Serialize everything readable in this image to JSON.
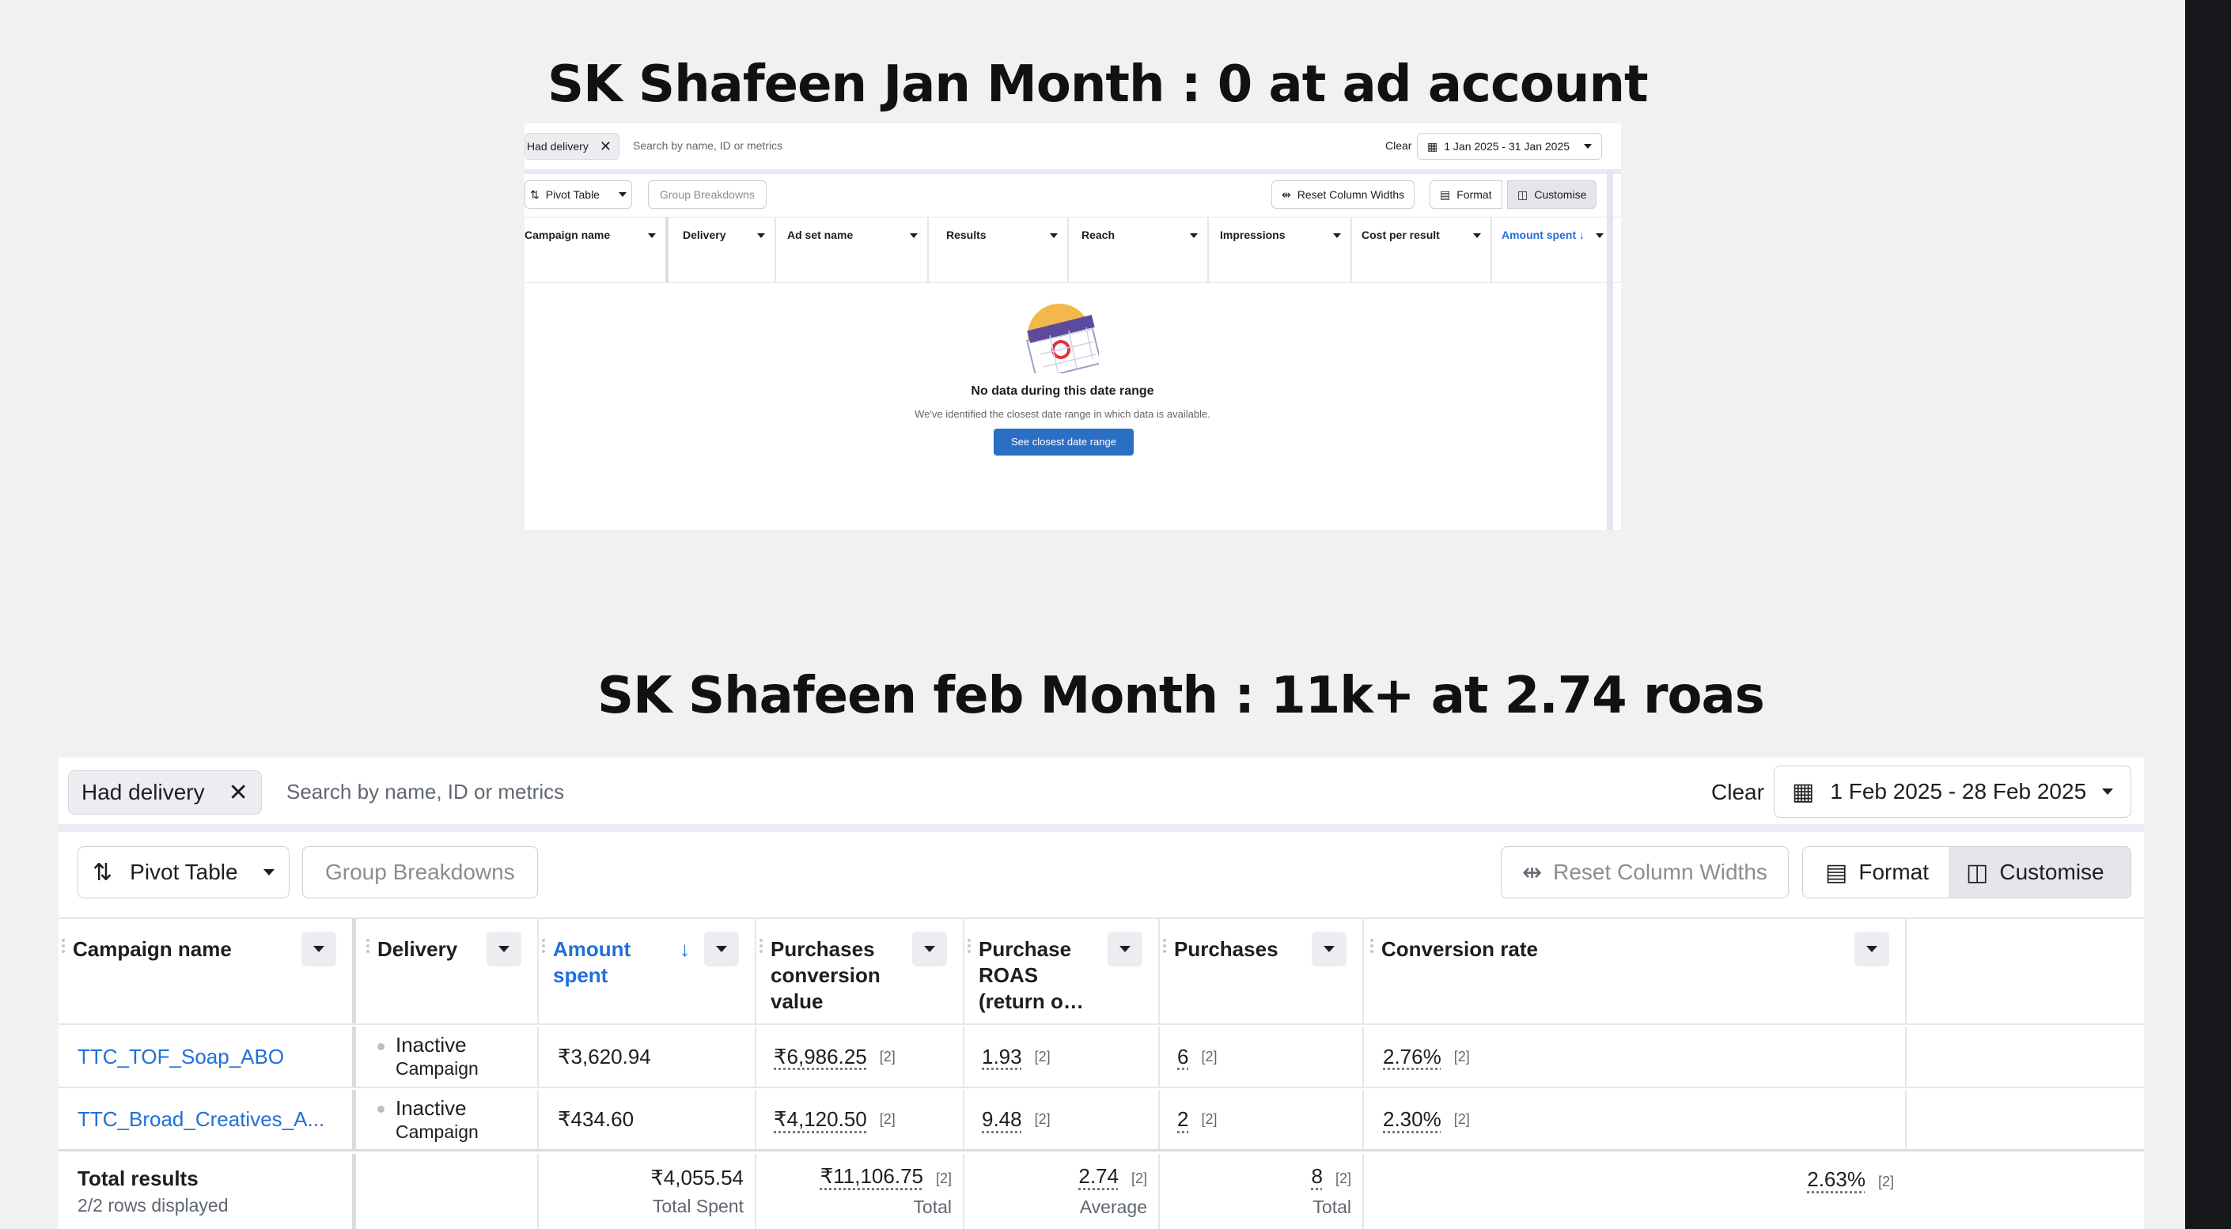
{
  "titles": {
    "jan": "SK Shafeen Jan Month  : 0 at ad account",
    "feb": "SK Shafeen feb Month  : 11k+ at 2.74 roas"
  },
  "jan_panel": {
    "filter_chip": "Had delivery",
    "search_placeholder": "Search by name, ID or metrics",
    "clear": "Clear",
    "date_range": "1 Jan 2025 - 31 Jan 2025",
    "pivot_table": "Pivot Table",
    "group_breakdowns": "Group Breakdowns",
    "reset_column_widths": "Reset Column Widths",
    "format": "Format",
    "customise": "Customise",
    "columns": [
      "Campaign name",
      "Delivery",
      "Ad set name",
      "Results",
      "Reach",
      "Impressions",
      "Cost per result",
      "Amount spent ↓"
    ],
    "empty_title": "No data during this date range",
    "empty_desc": "We've identified the closest date range in which data is available.",
    "empty_button": "See closest date range"
  },
  "feb_panel": {
    "filter_chip": "Had delivery",
    "search_placeholder": "Search by name, ID or metrics",
    "clear": "Clear",
    "date_range": "1 Feb 2025 - 28 Feb 2025",
    "pivot_table": "Pivot Table",
    "group_breakdowns": "Group Breakdowns",
    "reset_column_widths": "Reset Column Widths",
    "format": "Format",
    "customise": "Customise",
    "columns": {
      "campaign_name": "Campaign name",
      "delivery": "Delivery",
      "amount_spent_1": "Amount",
      "amount_spent_2": "spent",
      "purchases_value_1": "Purchases",
      "purchases_value_2": "conversion",
      "purchases_value_3": "value",
      "roas_1": "Purchase",
      "roas_2": "ROAS",
      "roas_3": "(return o…",
      "purchases": "Purchases",
      "conversion_rate": "Conversion rate"
    },
    "rows": [
      {
        "campaign": "TTC_TOF_Soap_ABO",
        "delivery": "Inactive",
        "delivery_sub": "Campaign",
        "amount_spent": "₹3,620.94",
        "purchase_value": "₹6,986.25",
        "roas": "1.93",
        "purchases": "6",
        "conversion_rate": "2.76%",
        "note": "[2]"
      },
      {
        "campaign": "TTC_Broad_Creatives_A...",
        "delivery": "Inactive",
        "delivery_sub": "Campaign",
        "amount_spent": "₹434.60",
        "purchase_value": "₹4,120.50",
        "roas": "9.48",
        "purchases": "2",
        "conversion_rate": "2.30%",
        "note": "[2]"
      }
    ],
    "totals": {
      "label": "Total results",
      "rows_displayed": "2/2 rows displayed",
      "amount_spent": "₹4,055.54",
      "amount_spent_caption": "Total Spent",
      "purchase_value": "₹11,106.75",
      "purchase_value_caption": "Total",
      "roas": "2.74",
      "roas_caption": "Average",
      "purchases": "8",
      "purchases_caption": "Total",
      "conversion_rate": "2.63%",
      "note": "[2]"
    }
  }
}
